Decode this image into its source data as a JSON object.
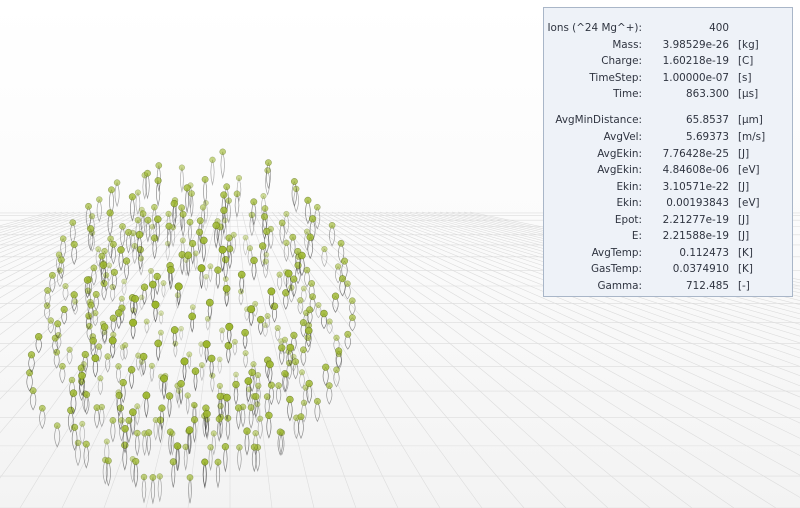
{
  "stats": [
    {
      "label": "Ions (^24 Mg^+):",
      "value": "400",
      "unit": ""
    },
    {
      "label": "Mass:",
      "value": "3.98529e-26",
      "unit": "[kg]"
    },
    {
      "label": "Charge:",
      "value": "1.60218e-19",
      "unit": "[C]"
    },
    {
      "label": "TimeStep:",
      "value": "1.00000e-07",
      "unit": "[s]"
    },
    {
      "label": "Time:",
      "value": "863.300",
      "unit": "[µs]"
    },
    {
      "label": "AvgMinDistance:",
      "value": "65.8537",
      "unit": "[µm]"
    },
    {
      "label": "AvgVel:",
      "value": "5.69373",
      "unit": "[m/s]"
    },
    {
      "label": "AvgEkin:",
      "value": "7.76428e-25",
      "unit": "[J]"
    },
    {
      "label": "AvgEkin:",
      "value": "4.84608e-06",
      "unit": "[eV]"
    },
    {
      "label": "Ekin:",
      "value": "3.10571e-22",
      "unit": "[J]"
    },
    {
      "label": "Ekin:",
      "value": "0.00193843",
      "unit": "[eV]"
    },
    {
      "label": "Epot:",
      "value": "2.21277e-19",
      "unit": "[J]"
    },
    {
      "label": "E:",
      "value": "2.21588e-19",
      "unit": "[J]"
    },
    {
      "label": "AvgTemp:",
      "value": "0.112473",
      "unit": "[K]"
    },
    {
      "label": "GasTemp:",
      "value": "0.0374910",
      "unit": "[K]"
    },
    {
      "label": "Gamma:",
      "value": "712.485",
      "unit": "[-]"
    }
  ],
  "scene": {
    "ion_count": 400,
    "ion_color": "#9bb52a",
    "ion_outline": "#4f5f14",
    "trail_color": "#2a2a2a",
    "grid_color": "#dcdcdc"
  }
}
